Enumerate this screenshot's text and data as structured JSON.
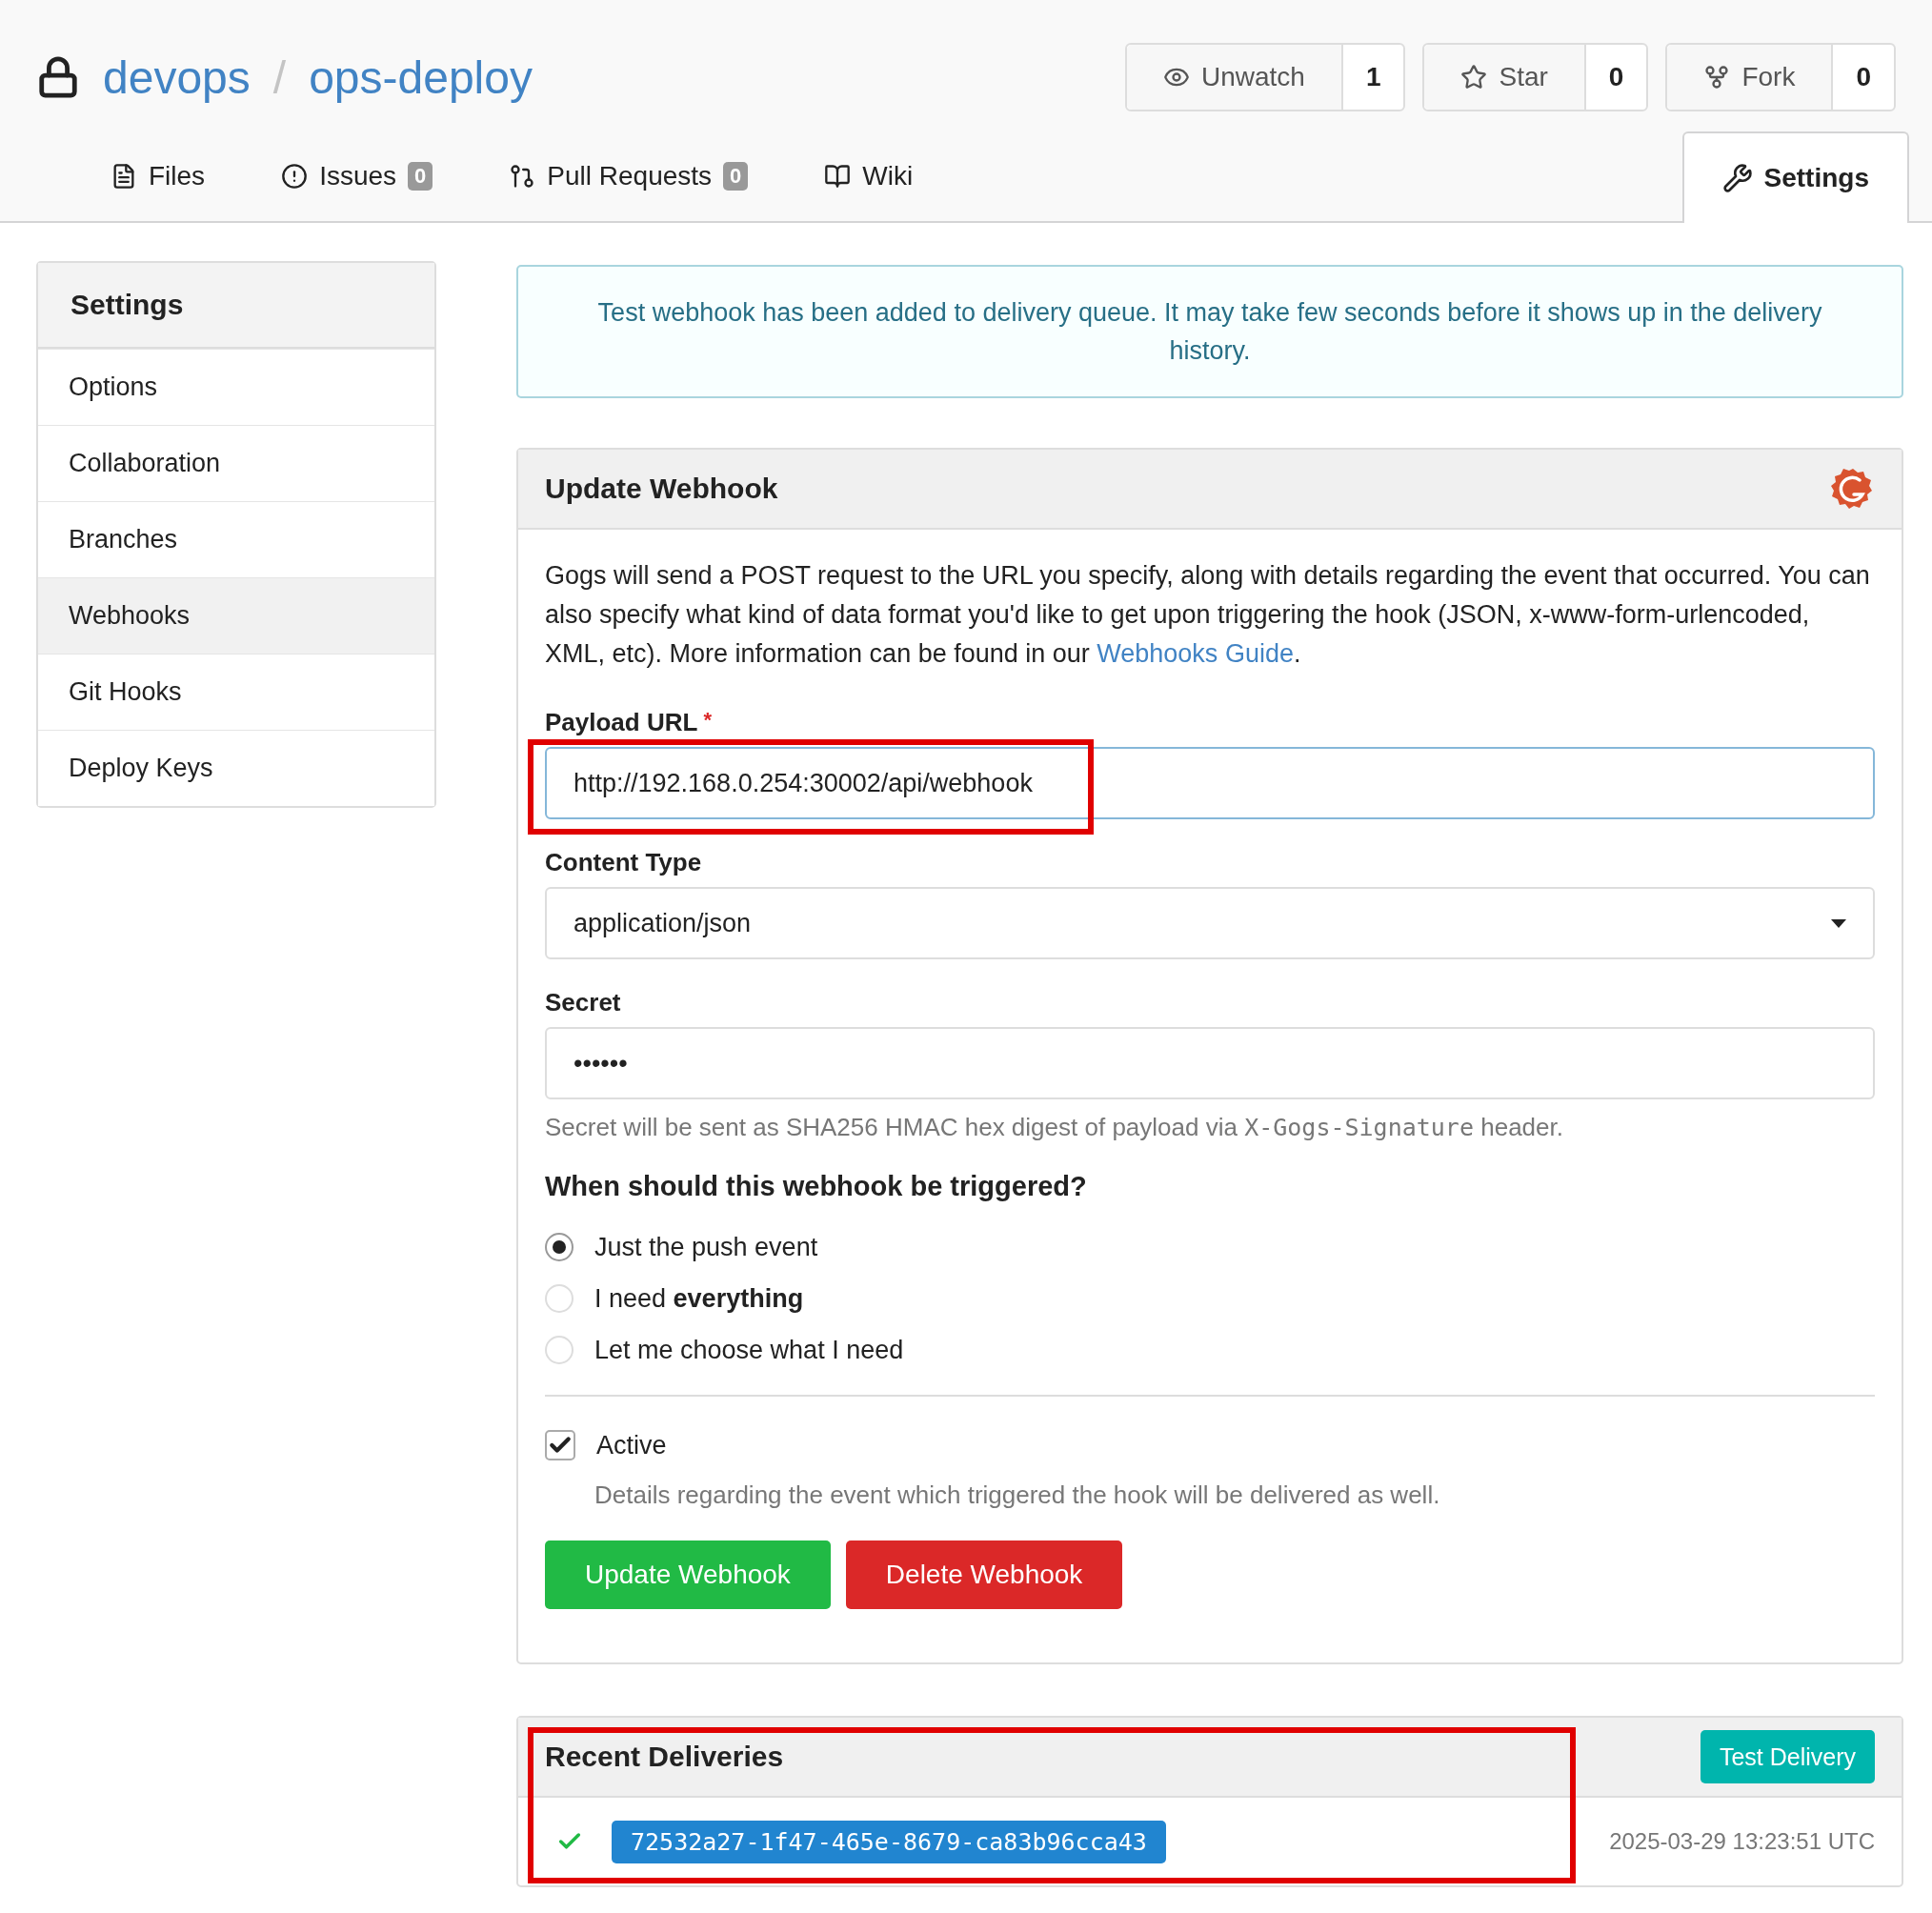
{
  "repo": {
    "owner": "devops",
    "separator": "/",
    "name": "ops-deploy",
    "private": true
  },
  "repo_actions": [
    {
      "kind": "watch",
      "label": "Unwatch",
      "count": "1"
    },
    {
      "kind": "star",
      "label": "Star",
      "count": "0"
    },
    {
      "kind": "fork",
      "label": "Fork",
      "count": "0"
    }
  ],
  "tabs": [
    {
      "kind": "files",
      "label": "Files",
      "selected": false
    },
    {
      "kind": "issues",
      "label": "Issues",
      "badge": "0",
      "selected": false
    },
    {
      "kind": "pulls",
      "label": "Pull Requests",
      "badge": "0",
      "selected": false
    },
    {
      "kind": "wiki",
      "label": "Wiki",
      "selected": false
    },
    {
      "kind": "settings",
      "label": "Settings",
      "selected": true
    }
  ],
  "sidebar": {
    "title": "Settings",
    "items": [
      {
        "label": "Options",
        "selected": false
      },
      {
        "label": "Collaboration",
        "selected": false
      },
      {
        "label": "Branches",
        "selected": false
      },
      {
        "label": "Webhooks",
        "selected": true
      },
      {
        "label": "Git Hooks",
        "selected": false
      },
      {
        "label": "Deploy Keys",
        "selected": false
      }
    ]
  },
  "alert": "Test webhook has been added to delivery queue. It may take few seconds before it shows up in the delivery history.",
  "webhook_form": {
    "title": "Update Webhook",
    "description": {
      "before": "Gogs will send a POST request to the URL you specify, along with details regarding the event that occurred. You can also specify what kind of data format you'd like to get upon triggering the hook (JSON, x-www-form-urlencoded, XML, etc). More information can be found in our ",
      "link": "Webhooks Guide",
      "after": "."
    },
    "payload_url": {
      "label": "Payload URL",
      "required_mark": "*",
      "value": "http://192.168.0.254:30002/api/webhook",
      "highlighted": true
    },
    "content_type": {
      "label": "Content Type",
      "value": "application/json"
    },
    "secret": {
      "label": "Secret",
      "value": "••••••",
      "hint": [
        "Secret will be sent as SHA256 HMAC hex digest of payload via ",
        "X-Gogs-Signature",
        " header."
      ]
    },
    "trigger_heading": "When should this webhook be triggered?",
    "trigger_options": [
      {
        "label": "Just the push event",
        "selected": true
      },
      {
        "label": "I need **everything**",
        "selected": false
      },
      {
        "label": "Let me choose what I need",
        "selected": false
      }
    ],
    "active": {
      "label": "Active",
      "checked": true,
      "hint": "Details regarding the event which triggered the hook will be delivered as well."
    },
    "buttons": [
      {
        "kind": "primary",
        "label": "Update Webhook"
      },
      {
        "kind": "danger",
        "label": "Delete Webhook"
      }
    ]
  },
  "recent_deliveries": {
    "title": "Recent Deliveries",
    "highlighted": true,
    "test_button": "Test Delivery",
    "items": [
      {
        "succeeded": true,
        "uuid": "72532a27-1f47-465e-8679-ca83b96cca43",
        "time": "2025-03-29 13:23:51 UTC"
      }
    ]
  }
}
